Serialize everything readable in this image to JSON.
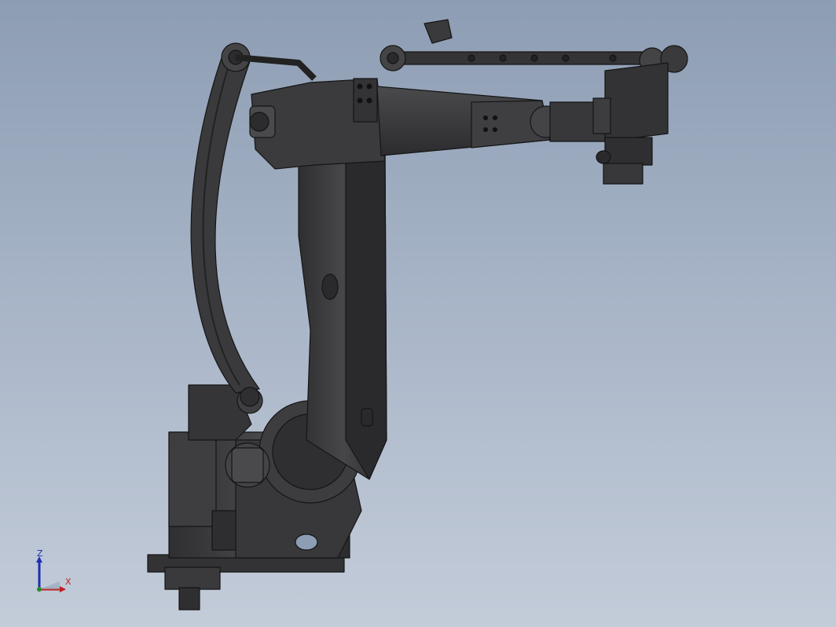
{
  "viewport": {
    "background_top": "#8d9db3",
    "background_bottom": "#c3ccd9",
    "model_color": "#3a3a3c",
    "edge_color": "#1a1a1a"
  },
  "model": {
    "subject": "palletizing-robot-arm"
  },
  "triad": {
    "z_label": "Z",
    "x_label": "X",
    "z_color": "#1e2fb0",
    "x_color": "#c02020",
    "y_color": "#2a8a2a"
  }
}
